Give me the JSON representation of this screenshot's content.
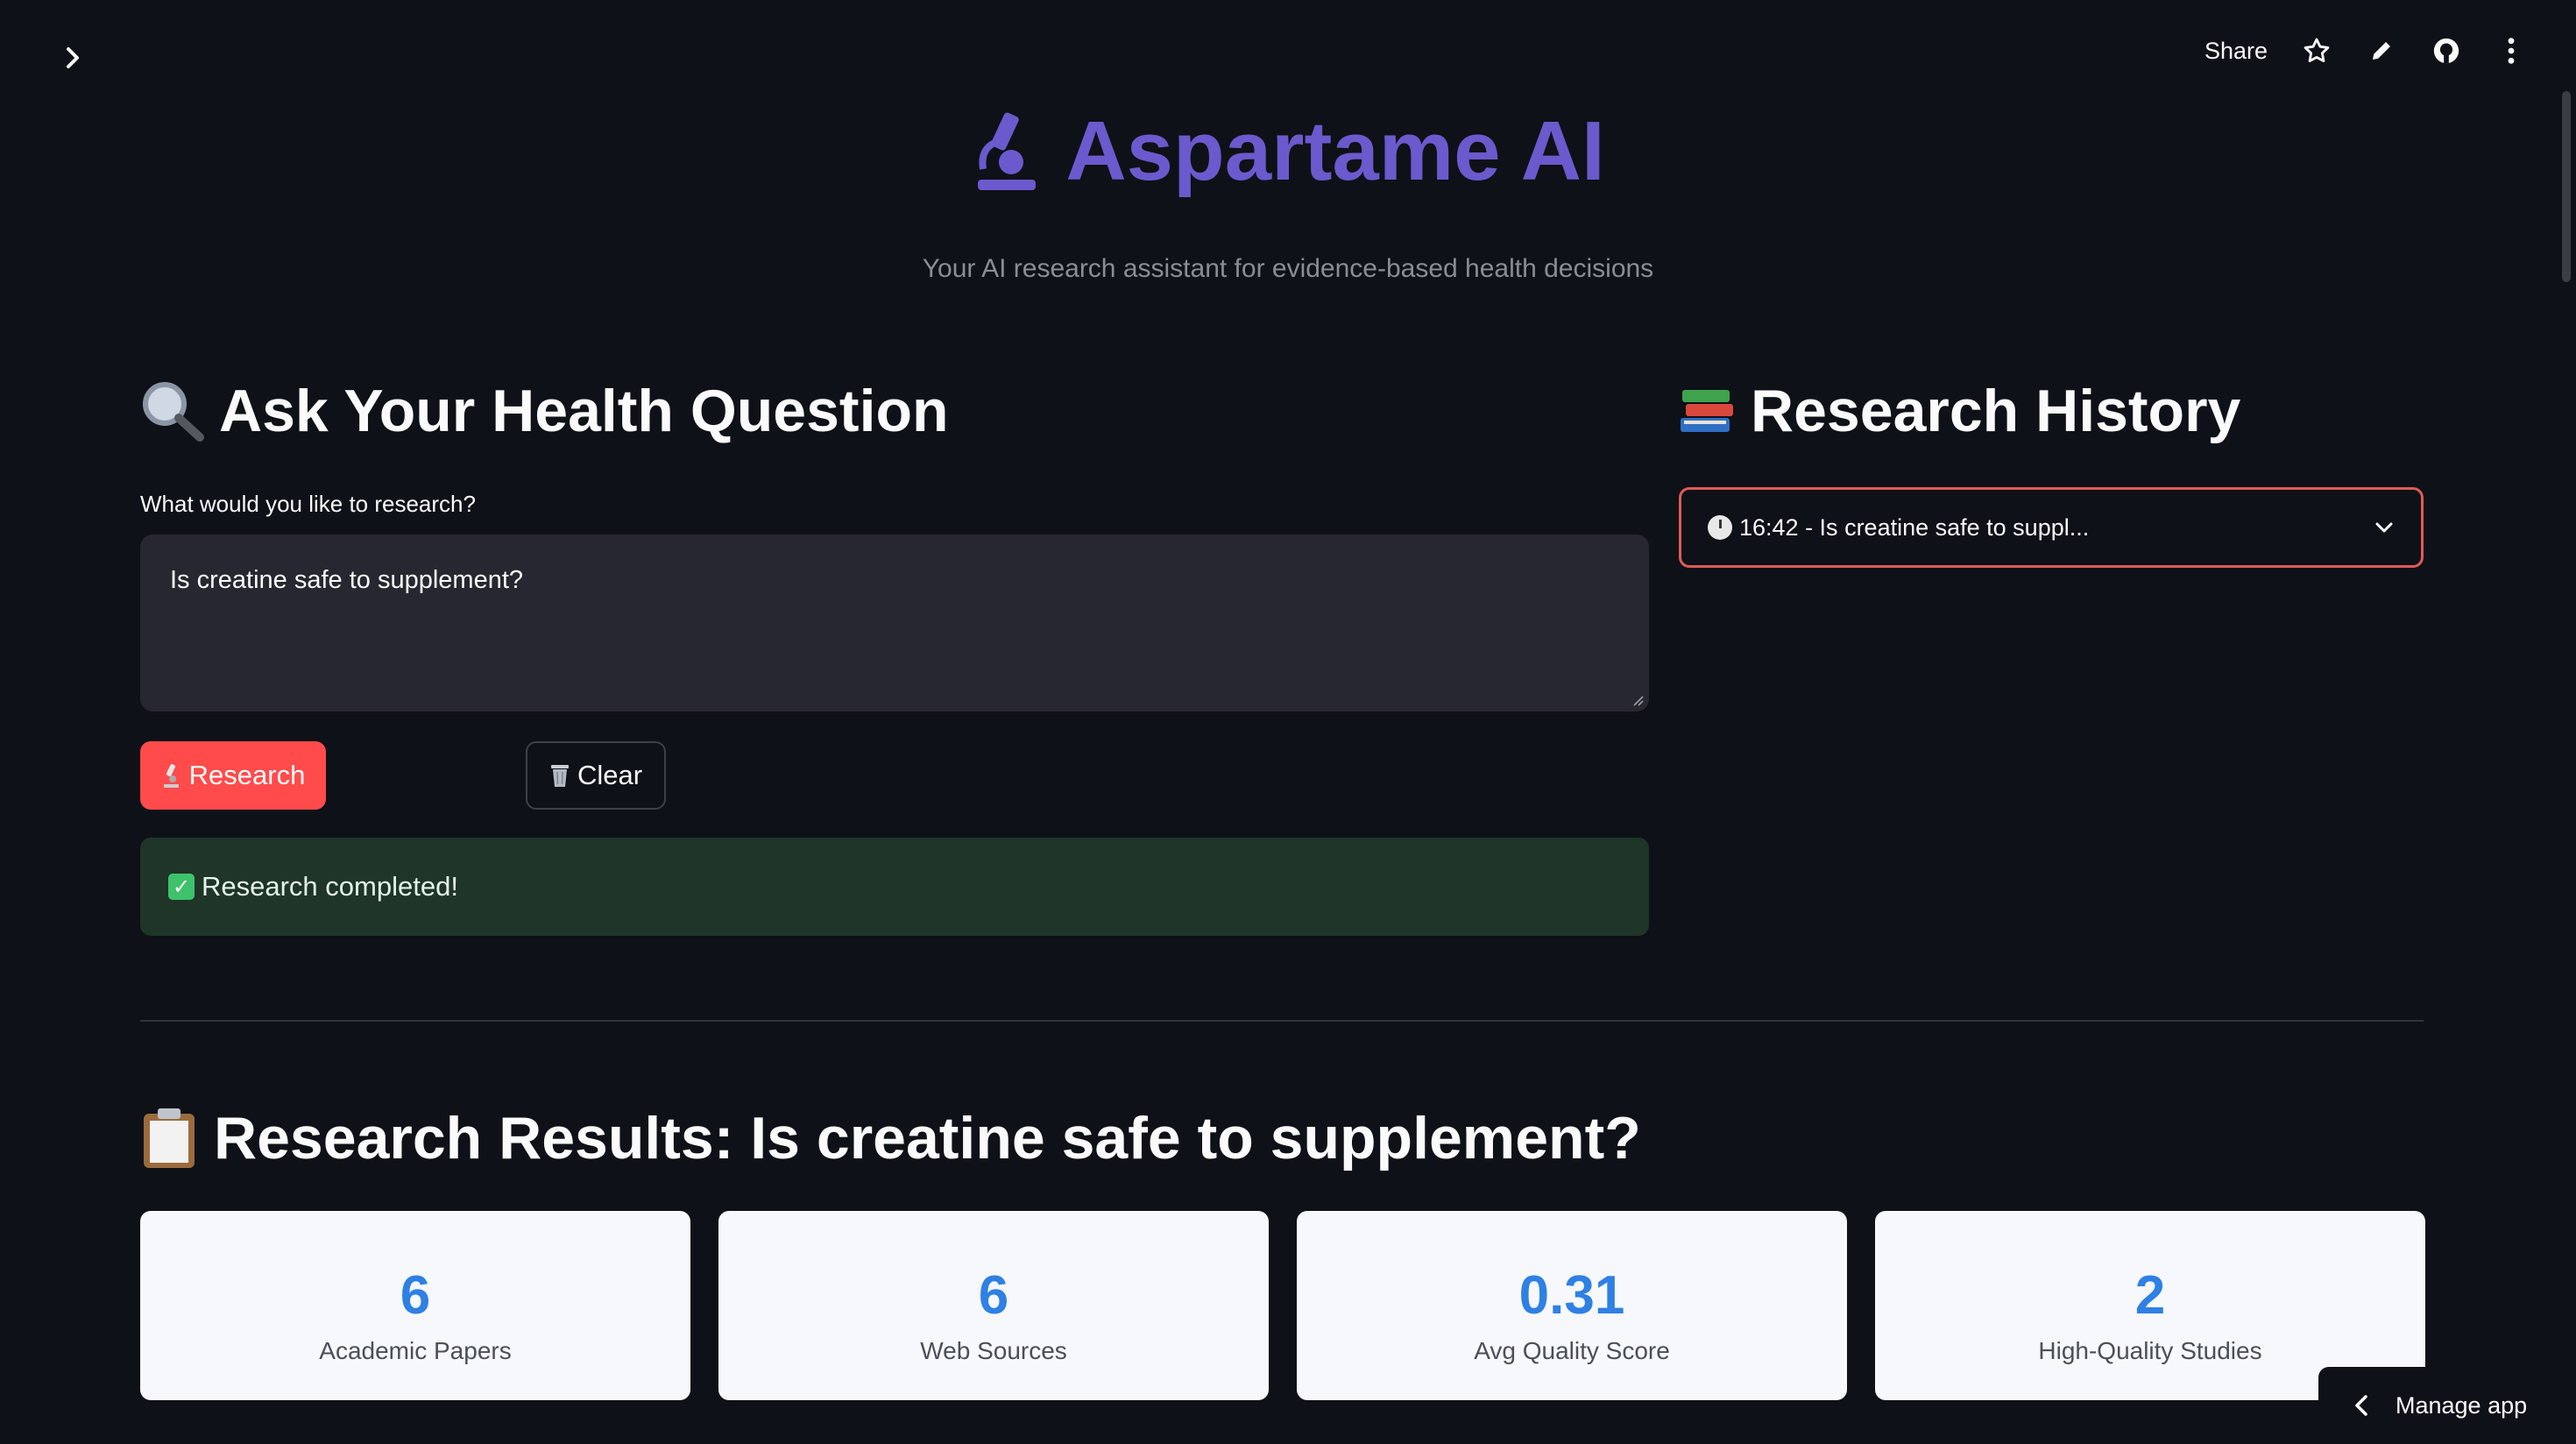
{
  "toolbar": {
    "share_label": "Share"
  },
  "header": {
    "title": "Aspartame AI",
    "subtitle": "Your AI research assistant for evidence-based health decisions",
    "title_color": "#6a5acd"
  },
  "ask_section": {
    "heading": "Ask Your Health Question",
    "field_label": "What would you like to research?",
    "question_value": "Is creatine safe to supplement?",
    "research_button": "Research",
    "clear_button": "Clear",
    "success_message": "Research completed!"
  },
  "history_section": {
    "heading": "Research History",
    "selected": "16:42 - Is creatine safe to suppl..."
  },
  "results": {
    "heading": "Research Results: Is creatine safe to supplement?",
    "metrics": [
      {
        "value": "6",
        "label": "Academic Papers"
      },
      {
        "value": "6",
        "label": "Web Sources"
      },
      {
        "value": "0.31",
        "label": "Avg Quality Score"
      },
      {
        "value": "2",
        "label": "High-Quality Studies"
      }
    ]
  },
  "footer": {
    "manage_app": "Manage app"
  },
  "colors": {
    "background": "#0e1117",
    "primary_button": "#ff4b4b",
    "success_bg": "#1f3528",
    "metric_value": "#2f80e4"
  },
  "icons": [
    "chevron-right-icon",
    "star-icon",
    "pencil-icon",
    "github-icon",
    "more-vertical-icon",
    "microscope-icon",
    "magnifier-icon",
    "books-icon",
    "clipboard-icon",
    "wastebasket-icon",
    "check-icon",
    "clock-icon",
    "chevron-down-icon",
    "chevron-left-icon"
  ]
}
